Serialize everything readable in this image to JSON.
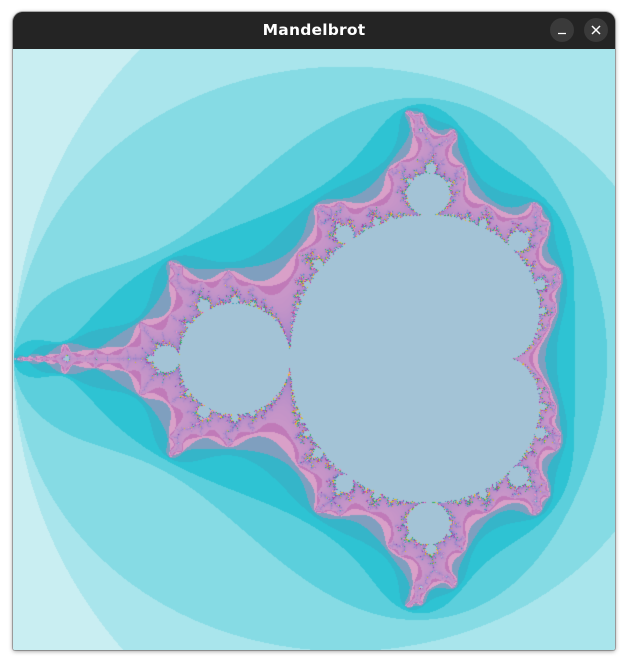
{
  "window": {
    "title": "Mandelbrot"
  },
  "titlebar_buttons": {
    "minimize": "minimize-icon",
    "close": "close-icon"
  },
  "fractal": {
    "kind": "Mandelbrot set",
    "interior_color": "#a3c3d6",
    "band_colors": [
      "#e3f7f9",
      "#c9eef2",
      "#a9e5ec",
      "#86dbe4",
      "#5ccfdc",
      "#2ec3d3",
      "#35b5c9",
      "#7f9fbf",
      "#d9a0c8",
      "#c07ab8"
    ],
    "noise_colors": [
      "#c0509a",
      "#e0c020",
      "#30b060",
      "#9040b0",
      "#f090c0",
      "#40a0c0"
    ]
  }
}
